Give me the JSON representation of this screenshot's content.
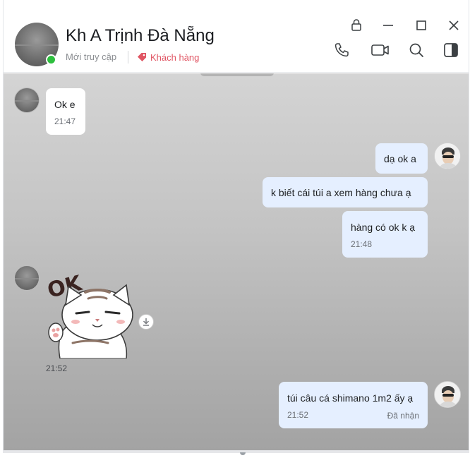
{
  "header": {
    "contact_name": "Kh A Trịnh Đà Nẵng",
    "status": "Mới truy cập",
    "tag_label": "Khách hàng",
    "tag_color": "#e05563",
    "online_color": "#2dbf3e",
    "window_controls": [
      "lock-icon",
      "minimize-icon",
      "maximize-icon",
      "close-icon"
    ],
    "tools": [
      "phone-icon",
      "video-call-icon",
      "search-icon",
      "side-panel-icon"
    ]
  },
  "messages": [
    {
      "side": "in",
      "text": "Ok e",
      "time": "21:47"
    },
    {
      "side": "out",
      "text": "dạ ok a"
    },
    {
      "side": "out",
      "text": "k biết cái túi a xem hàng chưa ạ"
    },
    {
      "side": "out",
      "text": "hàng có ok k ạ",
      "time": "21:48"
    },
    {
      "side": "in",
      "sticker": "ok-cat-sticker",
      "sticker_text": "OK",
      "time": "21:52"
    },
    {
      "side": "out",
      "text": "túi câu cá shimano 1m2 ấy ạ",
      "time": "21:52",
      "status": "Đã nhận"
    }
  ],
  "colors": {
    "outgoing_bubble": "#e5efff",
    "incoming_bubble": "#ffffff"
  }
}
